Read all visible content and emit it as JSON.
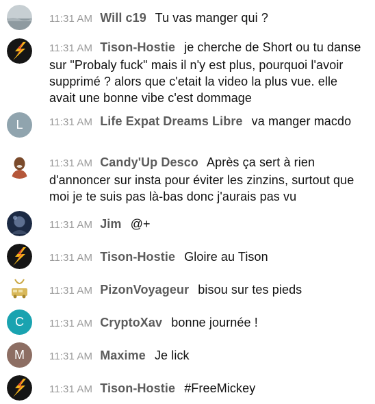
{
  "messages": [
    {
      "time": "11:31 AM",
      "user": "Will c19",
      "text": "Tu vas manger qui ?",
      "avatar": {
        "type": "image",
        "icon": "sea-photo-icon"
      }
    },
    {
      "time": "11:31 AM",
      "user": "Tison-Hostie",
      "text": "je cherche de Short ou tu danse sur \"Probaly fuck\" mais il n'y est plus, pourquoi l'avoir supprimé ? alors que c'etait la video la plus vue. elle avait une bonne vibe c'est dommage",
      "avatar": {
        "type": "image",
        "icon": "flame-logo-icon"
      }
    },
    {
      "time": "11:31 AM",
      "user": "Life Expat Dreams Libre",
      "text": "va manger macdo",
      "avatar": {
        "type": "letter",
        "letter": "L",
        "color": "#90a4ae"
      }
    },
    {
      "time": "11:31 AM",
      "user": "Candy'Up Desco",
      "text": "Après ça sert à rien d'annoncer sur insta pour éviter les zinzins, surtout que moi je te suis pas là-bas donc j'aurais pas vu",
      "avatar": {
        "type": "image",
        "icon": "person-photo-icon"
      }
    },
    {
      "time": "11:31 AM",
      "user": "Jim",
      "text": "@+",
      "avatar": {
        "type": "image",
        "icon": "dark-portrait-icon"
      }
    },
    {
      "time": "11:31 AM",
      "user": "Tison-Hostie",
      "text": "Gloire au Tison",
      "avatar": {
        "type": "image",
        "icon": "flame-logo-icon"
      }
    },
    {
      "time": "11:31 AM",
      "user": "PizonVoyageur",
      "text": "bisou sur tes pieds",
      "avatar": {
        "type": "image",
        "icon": "gold-chain-icon"
      }
    },
    {
      "time": "11:31 AM",
      "user": "CryptoXav",
      "text": "bonne journée !",
      "avatar": {
        "type": "letter",
        "letter": "C",
        "color": "#1aa3b0"
      }
    },
    {
      "time": "11:31 AM",
      "user": "Maxime",
      "text": "Je lick",
      "avatar": {
        "type": "letter",
        "letter": "M",
        "color": "#8d6e63"
      }
    },
    {
      "time": "11:31 AM",
      "user": "Tison-Hostie",
      "text": "#FreeMickey",
      "avatar": {
        "type": "image",
        "icon": "flame-logo-icon"
      }
    }
  ]
}
